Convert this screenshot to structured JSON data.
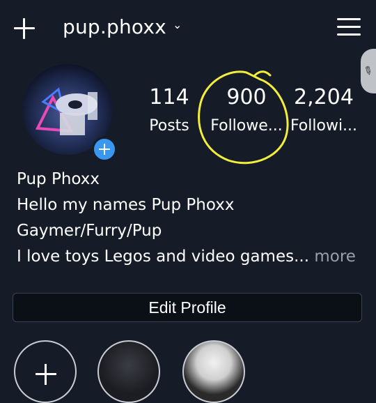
{
  "header": {
    "username": "pup.phoxx",
    "username_chevron": "⌄"
  },
  "profile": {
    "name": "Pup Phoxx",
    "avatar_icon": "profile-avatar",
    "badge_icon": "plus-icon"
  },
  "stats": [
    {
      "value": "114",
      "label": "Posts"
    },
    {
      "value": "900",
      "label": "Followe..."
    },
    {
      "value": "2,204",
      "label": "Followi..."
    }
  ],
  "bio": {
    "line1": "Pup Phoxx",
    "line2": "Hello my names Pup Phoxx",
    "line3": "Gaymer/Furry/Pup",
    "line4": "I love toys Legos and video games...",
    "more": "more"
  },
  "actions": {
    "edit_profile": "Edit Profile"
  },
  "annotation": {
    "color": "#f2ee3a",
    "icon": "hand-drawn-circle"
  },
  "colors": {
    "background": "#161c27",
    "accent": "#3a97f0"
  }
}
